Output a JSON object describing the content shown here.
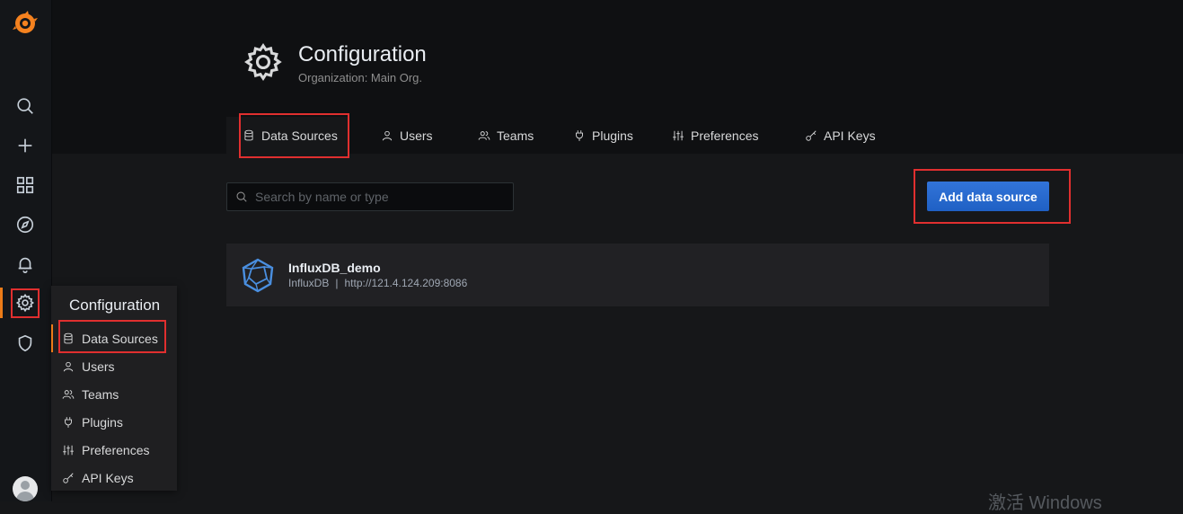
{
  "page": {
    "title": "Configuration",
    "subtitle": "Organization: Main Org."
  },
  "tabs": [
    {
      "label": "Data Sources",
      "icon": "database-icon",
      "active": true
    },
    {
      "label": "Users",
      "icon": "user-icon"
    },
    {
      "label": "Teams",
      "icon": "users-icon"
    },
    {
      "label": "Plugins",
      "icon": "plug-icon"
    },
    {
      "label": "Preferences",
      "icon": "sliders-icon"
    },
    {
      "label": "API Keys",
      "icon": "key-icon"
    }
  ],
  "search": {
    "placeholder": "Search by name or type",
    "value": ""
  },
  "actions": {
    "add_label": "Add data source"
  },
  "datasources": [
    {
      "name": "InfluxDB_demo",
      "type": "InfluxDB",
      "url": "http://121.4.124.209:8086"
    }
  ],
  "sidebar": {
    "icons": [
      "grafana-logo-icon",
      "search-icon",
      "plus-icon",
      "dashboards-icon",
      "explore-icon",
      "bell-icon",
      "gear-icon",
      "shield-icon"
    ]
  },
  "flyout": {
    "title": "Configuration",
    "items": [
      {
        "label": "Data Sources",
        "icon": "database-icon",
        "active": true
      },
      {
        "label": "Users",
        "icon": "user-icon"
      },
      {
        "label": "Teams",
        "icon": "users-icon"
      },
      {
        "label": "Plugins",
        "icon": "plug-icon"
      },
      {
        "label": "Preferences",
        "icon": "sliders-icon"
      },
      {
        "label": "API Keys",
        "icon": "key-icon"
      }
    ]
  },
  "watermark": "激活 Windows",
  "colors": {
    "accent": "#eb7b18",
    "primary_button": "#3274d9",
    "highlight_box": "#e02f2f"
  }
}
